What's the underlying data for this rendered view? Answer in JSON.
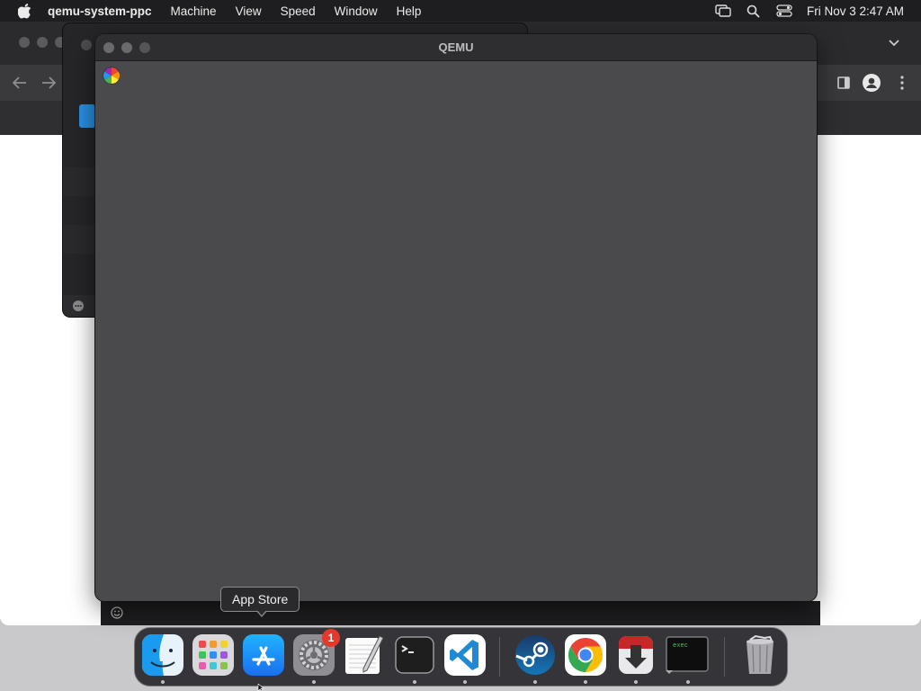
{
  "menubar": {
    "app_name": "qemu-system-ppc",
    "items": [
      "Machine",
      "View",
      "Speed",
      "Window",
      "Help"
    ],
    "clock": "Fri Nov 3  2:47 AM"
  },
  "qemu_window": {
    "title": "QEMU"
  },
  "tooltip": {
    "text": "App Store"
  },
  "dock": {
    "items": [
      {
        "name": "Finder",
        "icon": "finder-icon",
        "running": true
      },
      {
        "name": "Launchpad",
        "icon": "launchpad-icon",
        "running": false
      },
      {
        "name": "App Store",
        "icon": "app-store-icon",
        "running": false
      },
      {
        "name": "System Settings",
        "icon": "system-settings-icon",
        "running": true,
        "badge": "1"
      },
      {
        "name": "TextEdit",
        "icon": "textedit-icon",
        "running": false
      },
      {
        "name": "Terminal",
        "icon": "terminal-icon",
        "running": true
      },
      {
        "name": "Visual Studio Code",
        "icon": "vscode-icon",
        "running": true
      },
      {
        "name": "Steam",
        "icon": "steam-icon",
        "running": true
      },
      {
        "name": "Google Chrome",
        "icon": "chrome-icon",
        "running": true
      },
      {
        "name": "Transmit",
        "icon": "download-app-icon",
        "running": true
      },
      {
        "name": "exec",
        "icon": "exec-terminal-icon",
        "running": true
      },
      {
        "name": "Trash",
        "icon": "trash-icon",
        "running": false
      }
    ],
    "exec_icon_label": "exec"
  },
  "colors": {
    "menubar_bg": "#1e1d1f",
    "qemu_screen": "#4a494b",
    "badge": "#e5392c",
    "app_store_blue": "#1a8cf0",
    "vscode_blue": "#1f8ad2"
  }
}
